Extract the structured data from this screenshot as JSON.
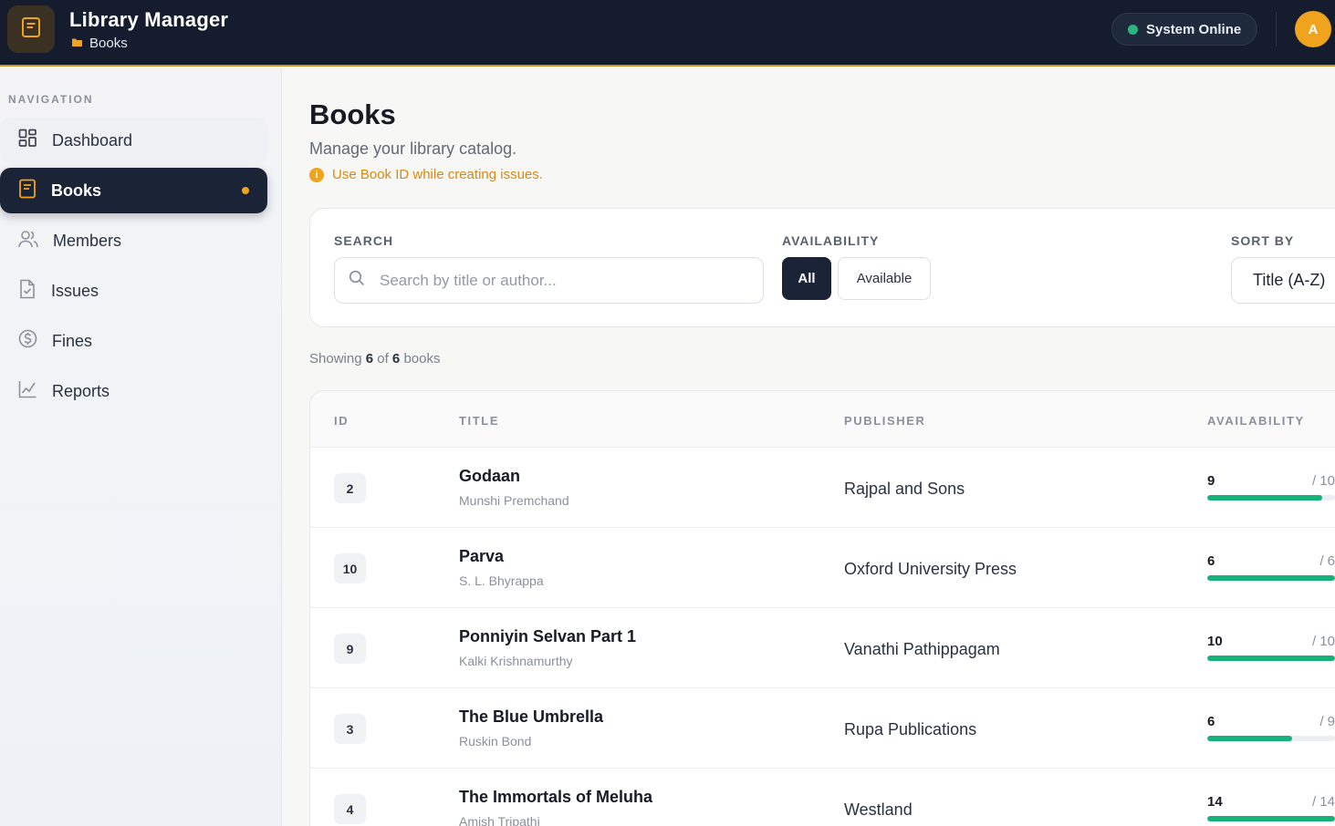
{
  "header": {
    "app_title": "Library Manager",
    "breadcrumb": "Books",
    "status": "System Online",
    "avatar_initial": "A"
  },
  "sidebar": {
    "heading": "NAVIGATION",
    "items": [
      {
        "label": "Dashboard",
        "icon": "grid-icon"
      },
      {
        "label": "Books",
        "icon": "book-icon",
        "active": true
      },
      {
        "label": "Members",
        "icon": "users-icon"
      },
      {
        "label": "Issues",
        "icon": "file-check-icon"
      },
      {
        "label": "Fines",
        "icon": "dollar-circle-icon"
      },
      {
        "label": "Reports",
        "icon": "chart-line-icon"
      }
    ]
  },
  "page": {
    "title": "Books",
    "subtitle": "Manage your library catalog.",
    "hint": "Use Book ID while creating issues."
  },
  "filters": {
    "search_label": "SEARCH",
    "search_placeholder": "Search by title or author...",
    "search_value": "",
    "availability_label": "AVAILABILITY",
    "availability_options": [
      "All",
      "Available"
    ],
    "availability_selected": "All",
    "sort_label": "SORT BY",
    "sort_value": "Title (A-Z)"
  },
  "summary": {
    "prefix": "Showing",
    "shown": "6",
    "middle": "of",
    "total": "6",
    "suffix": "books"
  },
  "table": {
    "columns": [
      "ID",
      "TITLE",
      "PUBLISHER",
      "AVAILABILITY"
    ],
    "rows": [
      {
        "id": "2",
        "title": "Godaan",
        "author": "Munshi Premchand",
        "publisher": "Rajpal and Sons",
        "available": 9,
        "total": 10,
        "available_text": "9",
        "total_text": "/ 10"
      },
      {
        "id": "10",
        "title": "Parva",
        "author": "S. L. Bhyrappa",
        "publisher": "Oxford University Press",
        "available": 6,
        "total": 6,
        "available_text": "6",
        "total_text": "/ 6"
      },
      {
        "id": "9",
        "title": "Ponniyin Selvan Part 1",
        "author": "Kalki Krishnamurthy",
        "publisher": "Vanathi Pathippagam",
        "available": 10,
        "total": 10,
        "available_text": "10",
        "total_text": "/ 10"
      },
      {
        "id": "3",
        "title": "The Blue Umbrella",
        "author": "Ruskin Bond",
        "publisher": "Rupa Publications",
        "available": 6,
        "total": 9,
        "available_text": "6",
        "total_text": "/ 9"
      },
      {
        "id": "4",
        "title": "The Immortals of Meluha",
        "author": "Amish Tripathi",
        "publisher": "Westland",
        "available": 14,
        "total": 14,
        "available_text": "14",
        "total_text": "/ 14"
      }
    ]
  },
  "colors": {
    "header_bg": "#141c2e",
    "accent": "#f0a31d",
    "status_green": "#2fb37e",
    "bar_green": "#17b27a",
    "hint_orange": "#d68a10"
  }
}
